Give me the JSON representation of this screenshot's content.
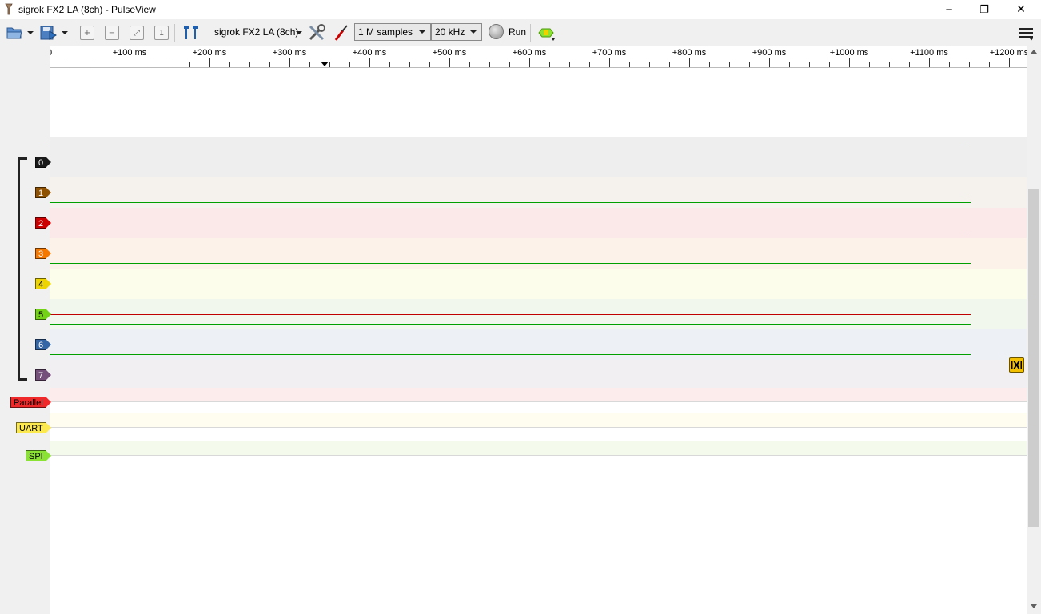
{
  "window": {
    "title": "sigrok FX2 LA (8ch) - PulseView",
    "minimize_glyph": "─",
    "maximize_glyph": "❐",
    "close_glyph": "✕"
  },
  "toolbar": {
    "device": "sigrok FX2 LA (8ch)",
    "sample_count": "1 M samples",
    "sample_rate": "20 kHz",
    "run_label": "Run",
    "icons": [
      "open-file-icon",
      "save-icon",
      "zoom-in-icon",
      "zoom-out-icon",
      "zoom-fit-icon",
      "zoom-one-to-one-icon",
      "cursors-icon",
      "device-config-icon",
      "probe-icon",
      "run-icon",
      "decoder-icon",
      "menu-icon"
    ]
  },
  "ruler": {
    "start_label": "0",
    "labels": [
      "+100 ms",
      "+200 ms",
      "+300 ms",
      "+400 ms",
      "+500 ms",
      "+600 ms",
      "+700 ms",
      "+800 ms",
      "+900 ms",
      "+1000 ms",
      "+1100 ms",
      "+1200 ms"
    ]
  },
  "channels": [
    {
      "name": "0",
      "color": "#1a1a1a",
      "text_color": "#ffffff",
      "row_bg": "#eeeeee",
      "level": "high"
    },
    {
      "name": "1",
      "color": "#8f5202",
      "text_color": "#ffffff",
      "row_bg": "#f5f1ec",
      "level": "low-high"
    },
    {
      "name": "2",
      "color": "#cc0000",
      "text_color": "#ffffff",
      "row_bg": "#fbe9e9",
      "level": "high"
    },
    {
      "name": "3",
      "color": "#f57900",
      "text_color": "#ffffff",
      "row_bg": "#fcf2ea",
      "level": "high"
    },
    {
      "name": "4",
      "color": "#edd400",
      "text_color": "#000000",
      "row_bg": "#fdfdec",
      "level": "none"
    },
    {
      "name": "5",
      "color": "#73d216",
      "text_color": "#000000",
      "row_bg": "#f1f7ec",
      "level": "low-high"
    },
    {
      "name": "6",
      "color": "#3465a4",
      "text_color": "#ffffff",
      "row_bg": "#edf0f5",
      "level": "high"
    },
    {
      "name": "7",
      "color": "#75507b",
      "text_color": "#ffffff",
      "row_bg": "#f2eff3",
      "level": "none"
    }
  ],
  "decoders": [
    {
      "name": "Parallel",
      "color": "#ef2929",
      "text_color": "#000000",
      "row_bg": "#fcecec"
    },
    {
      "name": "UART",
      "color": "#fce94f",
      "text_color": "#000000",
      "row_bg": "#fefdf0"
    },
    {
      "name": "SPI",
      "color": "#8ae234",
      "text_color": "#000000",
      "row_bg": "#f4fbed"
    }
  ],
  "colors": {
    "signal_high": "#00a000",
    "signal_low": "#c00000"
  }
}
